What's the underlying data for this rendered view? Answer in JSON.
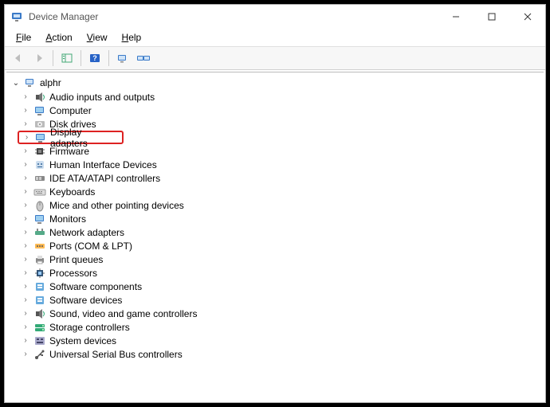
{
  "window": {
    "title": "Device Manager"
  },
  "menu": {
    "file": "File",
    "action": "Action",
    "view": "View",
    "help": "Help"
  },
  "root": {
    "name": "alphr"
  },
  "categories": [
    {
      "label": "Audio inputs and outputs",
      "icon": "speaker"
    },
    {
      "label": "Computer",
      "icon": "monitor"
    },
    {
      "label": "Disk drives",
      "icon": "disk"
    },
    {
      "label": "Display adapters",
      "icon": "monitor",
      "highlighted": true
    },
    {
      "label": "Firmware",
      "icon": "chip"
    },
    {
      "label": "Human Interface Devices",
      "icon": "hid"
    },
    {
      "label": "IDE ATA/ATAPI controllers",
      "icon": "ide"
    },
    {
      "label": "Keyboards",
      "icon": "keyboard"
    },
    {
      "label": "Mice and other pointing devices",
      "icon": "mouse"
    },
    {
      "label": "Monitors",
      "icon": "monitor"
    },
    {
      "label": "Network adapters",
      "icon": "network"
    },
    {
      "label": "Ports (COM & LPT)",
      "icon": "port"
    },
    {
      "label": "Print queues",
      "icon": "printer"
    },
    {
      "label": "Processors",
      "icon": "cpu"
    },
    {
      "label": "Software components",
      "icon": "software"
    },
    {
      "label": "Software devices",
      "icon": "software"
    },
    {
      "label": "Sound, video and game controllers",
      "icon": "speaker"
    },
    {
      "label": "Storage controllers",
      "icon": "storage"
    },
    {
      "label": "System devices",
      "icon": "system"
    },
    {
      "label": "Universal Serial Bus controllers",
      "icon": "usb"
    }
  ]
}
